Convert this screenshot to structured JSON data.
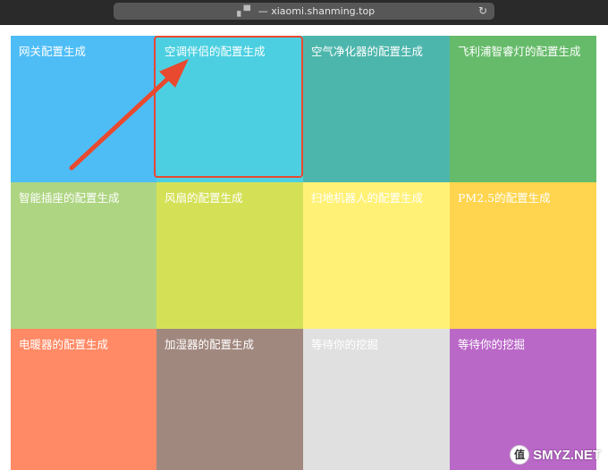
{
  "browser": {
    "address_marks": "▗▝▘",
    "url": "— xiaomi.shanming.top"
  },
  "tiles": [
    {
      "label": "网关配置生成",
      "color": "#4ebdf6"
    },
    {
      "label": "空调伴侣的配置生成",
      "color": "#4cd0e1"
    },
    {
      "label": "空气净化器的配置生成",
      "color": "#4db6ac"
    },
    {
      "label": "飞利浦智睿灯的配置生成",
      "color": "#66bb6a"
    },
    {
      "label": "智能插座的配置生成",
      "color": "#aed581"
    },
    {
      "label": "风扇的配置生成",
      "color": "#d4e157"
    },
    {
      "label": "扫地机器人的配置生成",
      "color": "#fff176"
    },
    {
      "label": "PM2.5的配置生成",
      "color": "#ffd54f"
    },
    {
      "label": "电暖器的配置生成",
      "color": "#ff8a65"
    },
    {
      "label": "加湿器的配置生成",
      "color": "#a1887f"
    },
    {
      "label": "等待你的挖掘",
      "color": "#e0e0e0"
    },
    {
      "label": "等待你的挖掘",
      "color": "#ba68c8"
    }
  ],
  "annotation": {
    "highlight_color": "#e8492f"
  },
  "watermark": {
    "badge": "值",
    "text": "SMYZ.NET"
  }
}
